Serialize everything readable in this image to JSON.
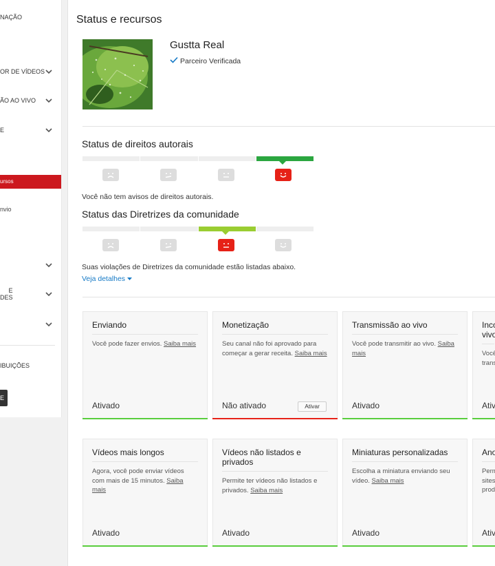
{
  "sidebar": {
    "items": [
      {
        "label": "NAÇÃO"
      },
      {
        "label": "OR DE VÍDEOS"
      },
      {
        "label": "ÃO AO VIVO"
      },
      {
        "label": "E"
      },
      {
        "label": "ursos"
      },
      {
        "label": "nvio"
      },
      {
        "label": ""
      },
      {
        "label": "E\nDES"
      },
      {
        "label": ""
      },
      {
        "label": "IBUIÇÕES"
      },
      {
        "label": "E"
      }
    ]
  },
  "page": {
    "title": "Status e recursos",
    "channel_name": "Gustta Real",
    "verified_label": "Parceiro Verificada"
  },
  "copyright": {
    "title": "Status de direitos autorais",
    "message": "Você não tem avisos de direitos autorais."
  },
  "community": {
    "title": "Status das Diretrizes da comunidade",
    "message": "Suas violações de Diretrizes da comunidade estão listadas abaixo.",
    "details_link": "Veja detalhes"
  },
  "cards_row1": [
    {
      "title": "Enviando",
      "desc": "Você pode fazer envios.",
      "link": "Saiba mais",
      "status": "Ativado",
      "state": "green"
    },
    {
      "title": "Monetização",
      "desc": "Seu canal não foi aprovado para começar a gerar receita.",
      "link": "Saiba mais",
      "status": "Não ativado",
      "state": "red",
      "button": "Ativar"
    },
    {
      "title": "Transmissão ao vivo",
      "desc": "Você pode transmitir ao vivo.",
      "link": "Saiba mais",
      "status": "Ativado",
      "state": "green"
    },
    {
      "title": "Inco vivo",
      "desc": "Você trans",
      "link": "",
      "status": "Ativ",
      "state": "green"
    }
  ],
  "cards_row2": [
    {
      "title": "Vídeos mais longos",
      "desc": "Agora, você pode enviar vídeos com mais de 15 minutos.",
      "link": "Saiba mais",
      "status": "Ativado",
      "state": "green"
    },
    {
      "title": "Vídeos não listados e privados",
      "desc": "Permite ter vídeos não listados e privados.",
      "link": "Saiba mais",
      "status": "Ativado",
      "state": "green"
    },
    {
      "title": "Miniaturas personalizadas",
      "desc": "Escolha a miniatura enviando seu vídeo.",
      "link": "Saiba mais",
      "status": "Ativado",
      "state": "green"
    },
    {
      "title": "Ano",
      "desc": "Perm sites prod",
      "link": "",
      "status": "Ativ",
      "state": "green"
    }
  ],
  "colors": {
    "accent_red": "#cc181e",
    "status_green": "#59cd3c",
    "link_blue": "#167ac6"
  }
}
